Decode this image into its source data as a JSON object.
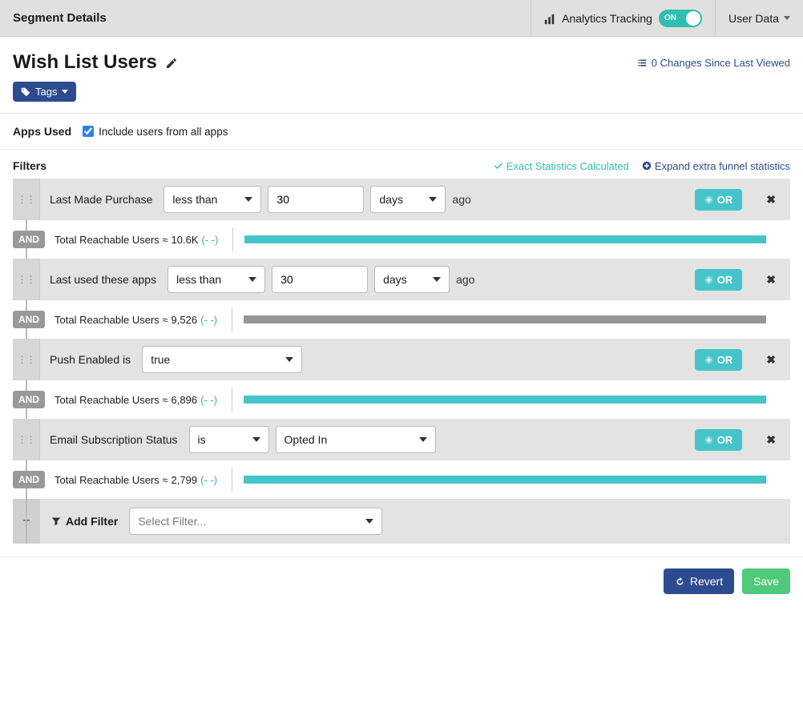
{
  "header": {
    "title": "Segment Details",
    "tracking_label": "Analytics Tracking",
    "toggle_state": "ON",
    "user_menu": "User Data"
  },
  "segment": {
    "name": "Wish List Users",
    "changes_text": "0 Changes Since Last Viewed",
    "tags_label": "Tags"
  },
  "apps": {
    "label": "Apps Used",
    "include_label": "Include users from all apps",
    "include_checked": true
  },
  "filters_head": {
    "label": "Filters",
    "stats_text": "Exact Statistics Calculated",
    "expand_text": "Expand extra funnel statistics"
  },
  "common": {
    "or_label": "OR",
    "and_label": "AND",
    "ago": "ago",
    "dashdash": "(- -)",
    "reachable_prefix": "Total Reachable Users ≈"
  },
  "filters": [
    {
      "label": "Last Made Purchase",
      "op": "less than",
      "value": "30",
      "unit": "days",
      "has_unit": true,
      "has_value": true,
      "has_second_select": false,
      "reachable": "10.6K",
      "bar_color": "teal",
      "bar_width": "100%"
    },
    {
      "label": "Last used these apps",
      "op": "less than",
      "value": "30",
      "unit": "days",
      "has_unit": true,
      "has_value": true,
      "has_second_select": false,
      "reachable": "9,526",
      "bar_color": "gray",
      "bar_width": "100%"
    },
    {
      "label": "Push Enabled is",
      "op": "true",
      "has_unit": false,
      "has_value": false,
      "has_second_select": false,
      "op_width": "w-lg",
      "reachable": "6,896",
      "bar_color": "teal",
      "bar_width": "100%"
    },
    {
      "label": "Email Subscription Status",
      "op": "is",
      "has_unit": false,
      "has_value": false,
      "has_second_select": true,
      "second": "Opted In",
      "op_width": "w-sm",
      "reachable": "2,799",
      "bar_color": "teal",
      "bar_width": "100%"
    }
  ],
  "add": {
    "label": "Add Filter",
    "placeholder": "Select Filter..."
  },
  "footer": {
    "revert": "Revert",
    "save": "Save"
  }
}
